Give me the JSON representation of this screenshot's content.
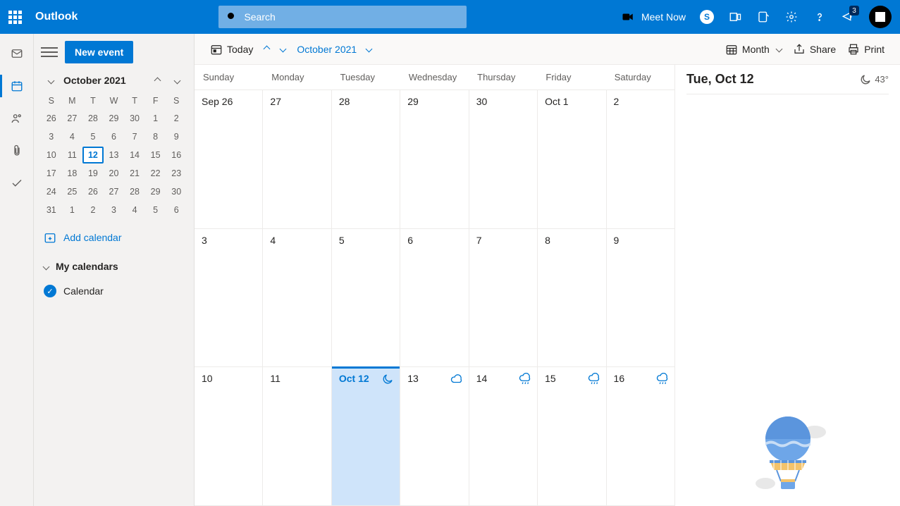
{
  "header": {
    "brand": "Outlook",
    "search_placeholder": "Search",
    "meet_now": "Meet Now",
    "notification_count": "3"
  },
  "sidebar": {
    "new_event": "New event",
    "mini_title": "October 2021",
    "dow": [
      "S",
      "M",
      "T",
      "W",
      "T",
      "F",
      "S"
    ],
    "mini_days": [
      [
        "26",
        "27",
        "28",
        "29",
        "30",
        "1",
        "2"
      ],
      [
        "3",
        "4",
        "5",
        "6",
        "7",
        "8",
        "9"
      ],
      [
        "10",
        "11",
        "12",
        "13",
        "14",
        "15",
        "16"
      ],
      [
        "17",
        "18",
        "19",
        "20",
        "21",
        "22",
        "23"
      ],
      [
        "24",
        "25",
        "26",
        "27",
        "28",
        "29",
        "30"
      ],
      [
        "31",
        "1",
        "2",
        "3",
        "4",
        "5",
        "6"
      ]
    ],
    "today_index": [
      2,
      2
    ],
    "add_calendar": "Add calendar",
    "my_calendars": "My calendars",
    "calendar_item": "Calendar"
  },
  "toolbar": {
    "today": "Today",
    "month_label": "October 2021",
    "view": "Month",
    "share": "Share",
    "print": "Print"
  },
  "monthView": {
    "dow": [
      "Sunday",
      "Monday",
      "Tuesday",
      "Wednesday",
      "Thursday",
      "Friday",
      "Saturday"
    ],
    "weeks": [
      [
        {
          "label": "Sep 26"
        },
        {
          "label": "27"
        },
        {
          "label": "28"
        },
        {
          "label": "29"
        },
        {
          "label": "30"
        },
        {
          "label": "Oct 1"
        },
        {
          "label": "2"
        }
      ],
      [
        {
          "label": "3"
        },
        {
          "label": "4"
        },
        {
          "label": "5"
        },
        {
          "label": "6"
        },
        {
          "label": "7"
        },
        {
          "label": "8"
        },
        {
          "label": "9"
        }
      ],
      [
        {
          "label": "10"
        },
        {
          "label": "11"
        },
        {
          "label": "Oct 12",
          "today": true,
          "wx": "moon"
        },
        {
          "label": "13",
          "wx": "cloud"
        },
        {
          "label": "14",
          "wx": "rain"
        },
        {
          "label": "15",
          "wx": "rain"
        },
        {
          "label": "16",
          "wx": "rain"
        }
      ]
    ]
  },
  "detail": {
    "title": "Tue, Oct 12",
    "temp": "43°"
  }
}
